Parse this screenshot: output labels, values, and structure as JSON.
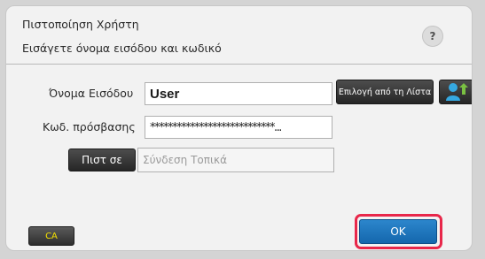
{
  "dialog": {
    "title": "Πιστοποίηση Χρήστη",
    "help_label": "?",
    "subtitle": "Εισάγετε όνομα εισόδου και κωδικό"
  },
  "form": {
    "username_label": "Όνομα Εισόδου",
    "username_value": "User",
    "password_label": "Κωδ. πρόσβασης",
    "password_value": "****************************...",
    "select_from_list_label": "Επιλογή από τη Λίστα",
    "auth_button_label": "Πιστ σε",
    "login_location_value": "Σύνδεση Τοπικά"
  },
  "footer": {
    "ca_label": "CA",
    "ok_label": "OK"
  },
  "colors": {
    "ok_button": "#1a74bd",
    "highlight": "#e8274a",
    "ca_text": "#f5e100",
    "user_icon": "#35a8e0",
    "user_icon_arrow": "#7ac142"
  },
  "icons": {
    "help": "question-mark-icon",
    "user_picker": "user-arrow-icon"
  }
}
